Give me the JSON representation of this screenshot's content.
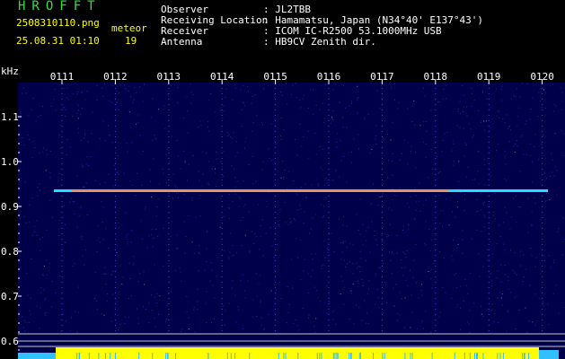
{
  "header": {
    "brand": "HROFFT",
    "filename": "2508310110.png",
    "timestamp": "25.08.31 01:10",
    "event_label": "meteor",
    "event_count": "19",
    "fields": [
      {
        "label": "Observer",
        "value": ": JL2TBB"
      },
      {
        "label": "Receiving Location",
        "value": ": Hamamatsu, Japan (N34°40' E137°43')"
      },
      {
        "label": "Receiver",
        "value": ": ICOM IC-R2500 53.1000MHz USB"
      },
      {
        "label": "Antenna",
        "value": ": HB9CV Zenith dir."
      }
    ]
  },
  "chart_data": {
    "type": "heatmap",
    "ylabel": "kHz",
    "x_ticks": [
      "0111",
      "0112",
      "0113",
      "0114",
      "0115",
      "0116",
      "0117",
      "0118",
      "0119",
      "0120"
    ],
    "y_ticks": [
      "1.1",
      "1.0",
      "0.9",
      "0.8",
      "0.7",
      "0.6"
    ],
    "ylim": [
      0.58,
      1.17
    ],
    "signal": {
      "frequency_khz": 0.935,
      "x_start": "0110.6",
      "x_end": "0120"
    },
    "colors": {
      "background": "#00004a",
      "noise": "#1a2aa0",
      "signal": "#20e0ff",
      "signal_core": "#ff8040",
      "power_bar": "#ffff00",
      "power_bar_edge": "#30c0ff"
    }
  }
}
